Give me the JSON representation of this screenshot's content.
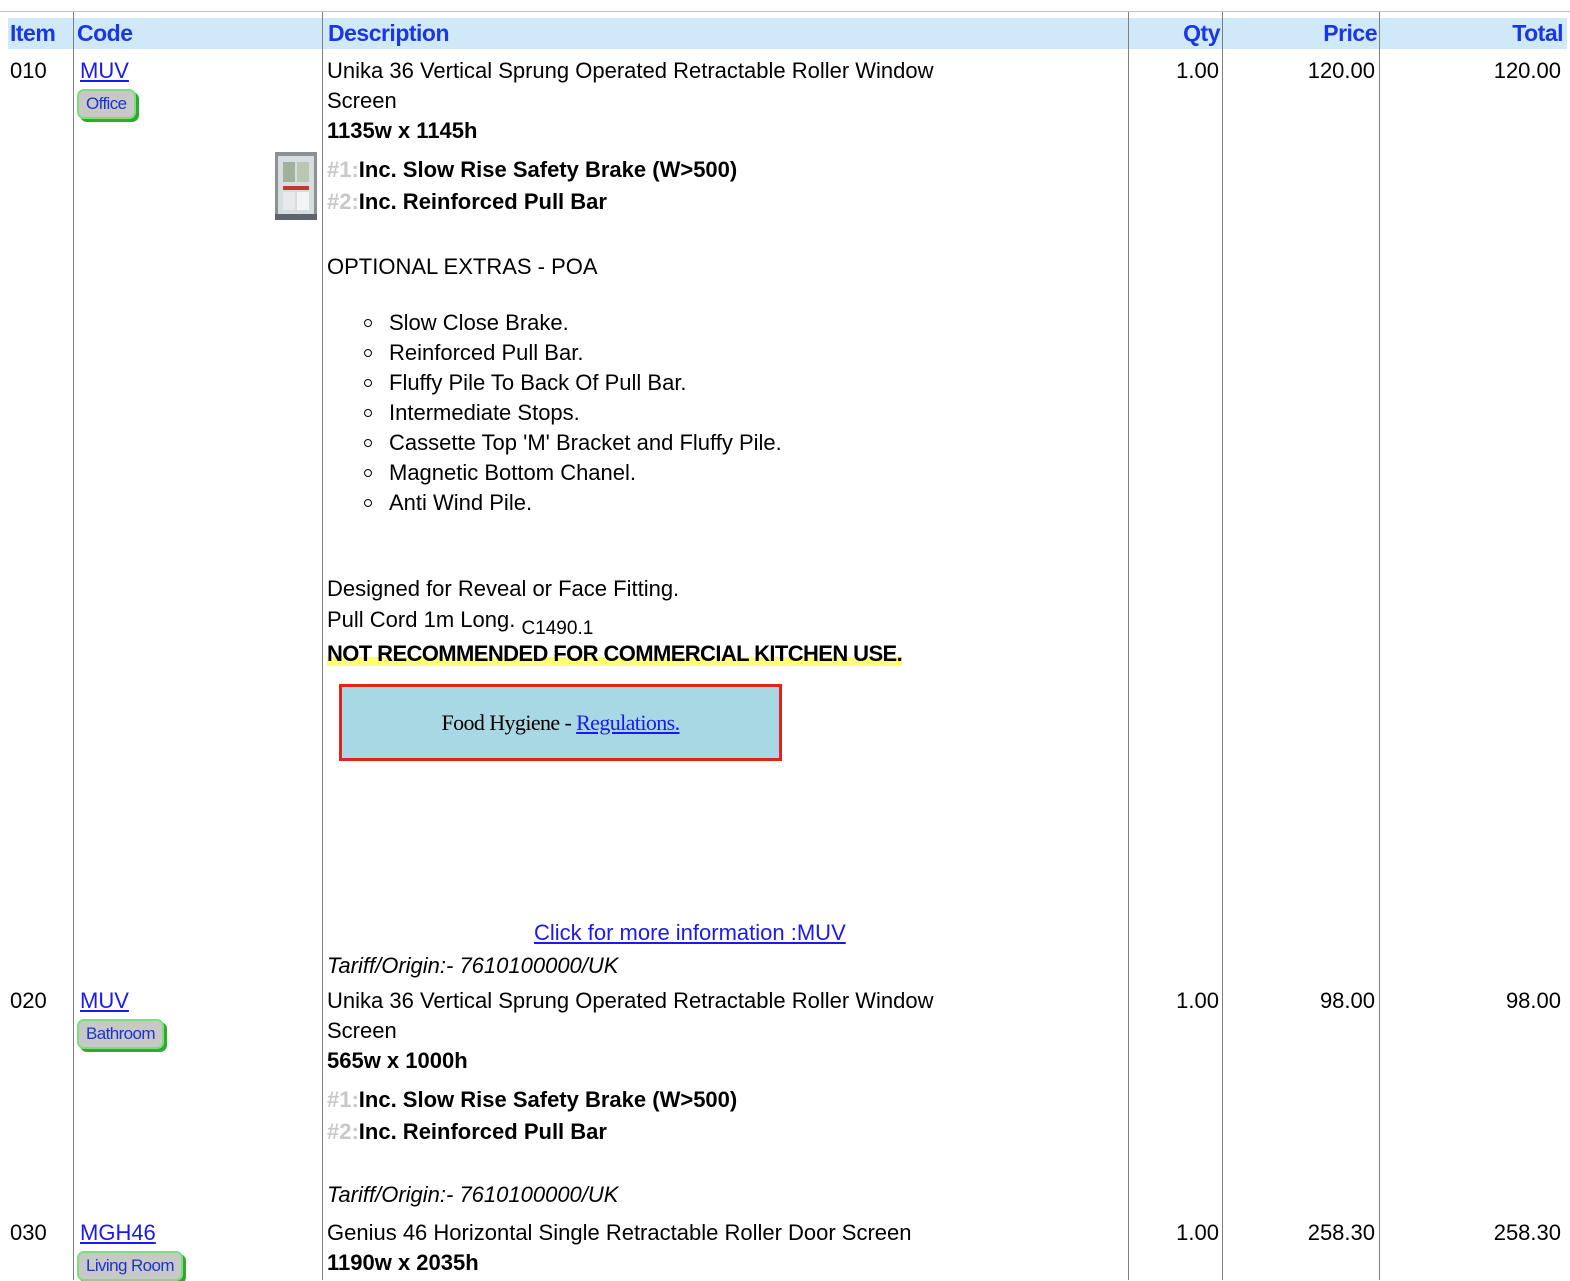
{
  "columns": {
    "item": "Item",
    "code": "Code",
    "description": "Description",
    "qty": "Qty",
    "price": "Price",
    "total": "Total"
  },
  "rows": [
    {
      "item": "010",
      "code": "MUV",
      "room": "Office",
      "description": "Unika 36 Vertical Sprung Operated Retractable Roller Window",
      "description_cont": "Screen",
      "size": "1135w x 1145h",
      "options": [
        {
          "num": "#1:",
          "text": "Inc. Slow Rise Safety Brake (W>500)"
        },
        {
          "num": "#2:",
          "text": "Inc. Reinforced Pull Bar"
        }
      ],
      "extras_heading": "OPTIONAL EXTRAS - POA",
      "extras": [
        "Slow Close Brake.",
        "Reinforced Pull Bar.",
        "Fluffy Pile To Back Of Pull Bar.",
        "Intermediate Stops.",
        "Cassette Top 'M' Bracket and Fluffy Pile.",
        "Magnetic Bottom Chanel.",
        "Anti Wind Pile."
      ],
      "fitting": "Designed for Reveal or Face Fitting.",
      "pull_cord": "Pull Cord 1m Long.",
      "ref": "C1490.1",
      "warning": "NOT RECOMMENDED FOR COMMERCIAL KITCHEN USE.",
      "hygiene_text": "Food Hygiene - ",
      "hygiene_link": "Regulations.",
      "more_info": "Click for more information :MUV",
      "tariff": "Tariff/Origin:- 7610100000/UK",
      "qty": "1.00",
      "price": "120.00",
      "total": "120.00"
    },
    {
      "item": "020",
      "code": "MUV",
      "room": "Bathroom",
      "description": "Unika 36 Vertical Sprung Operated Retractable Roller Window",
      "description_cont": "Screen",
      "size": "565w x 1000h",
      "options": [
        {
          "num": "#1:",
          "text": "Inc. Slow Rise Safety Brake (W>500)"
        },
        {
          "num": "#2:",
          "text": "Inc. Reinforced Pull Bar"
        }
      ],
      "tariff": "Tariff/Origin:- 7610100000/UK",
      "qty": "1.00",
      "price": "98.00",
      "total": "98.00"
    },
    {
      "item": "030",
      "code": "MGH46",
      "room": "Living Room",
      "description": "Genius 46 Horizontal Single Retractable Roller Door Screen",
      "size": "1190w x 2035h",
      "qty": "1.00",
      "price": "258.30",
      "total": "258.30"
    }
  ]
}
